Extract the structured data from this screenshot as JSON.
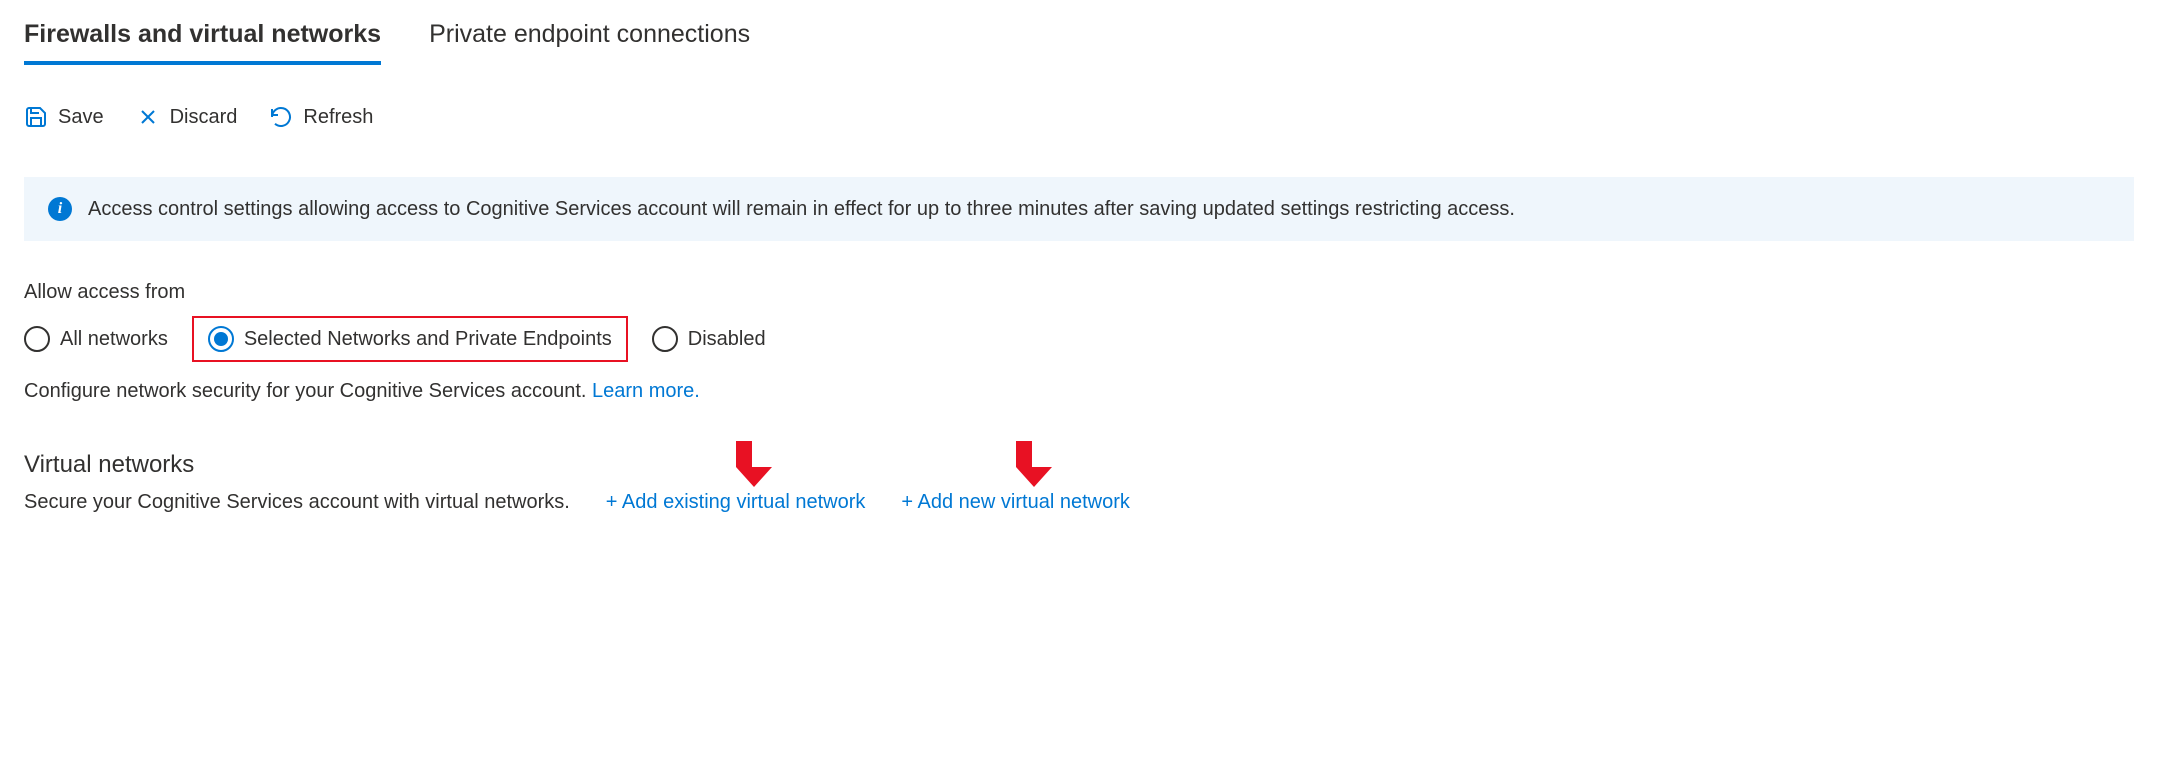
{
  "tabs": {
    "firewalls": "Firewalls and virtual networks",
    "private_endpoints": "Private endpoint connections"
  },
  "toolbar": {
    "save": "Save",
    "discard": "Discard",
    "refresh": "Refresh"
  },
  "info_banner": {
    "text": "Access control settings allowing access to Cognitive Services account will remain in effect for up to three minutes after saving updated settings restricting access."
  },
  "allow_access": {
    "label": "Allow access from",
    "options": {
      "all": "All networks",
      "selected": "Selected Networks and Private Endpoints",
      "disabled": "Disabled"
    }
  },
  "configure": {
    "text": "Configure network security for your Cognitive Services account. ",
    "learn_more": "Learn more."
  },
  "vnets": {
    "heading": "Virtual networks",
    "secure_text": "Secure your Cognitive Services account with virtual networks.",
    "add_existing": "+ Add existing virtual network",
    "add_new": "+ Add new virtual network"
  }
}
